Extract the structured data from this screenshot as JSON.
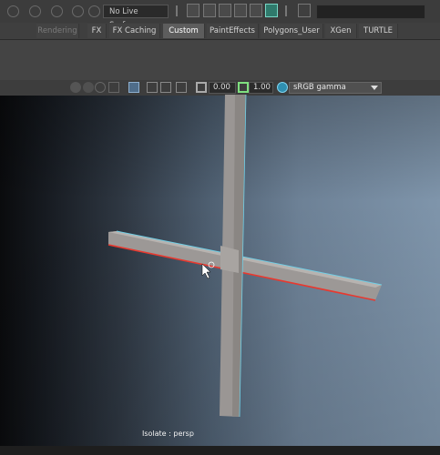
{
  "status_line": {
    "live_surface_label": "No Live Surface"
  },
  "shelf": {
    "tabs": [
      {
        "label": "Rendering"
      },
      {
        "label": "FX"
      },
      {
        "label": "FX Caching"
      },
      {
        "label": "Custom"
      },
      {
        "label": "PaintEffects"
      },
      {
        "label": "Polygons_User"
      },
      {
        "label": "XGen"
      },
      {
        "label": "TURTLE"
      }
    ],
    "active_tab": "Custom"
  },
  "viewport_toolbar": {
    "exposure_value": "0.00",
    "gamma_value": "1.00",
    "color_space": "sRGB gamma"
  },
  "viewport": {
    "hud_text": "Isolate : persp",
    "colors": {
      "selected_edge": "#e8392f",
      "highlight_edge": "#6fcfe6",
      "mesh_face": "#9a9694"
    }
  }
}
